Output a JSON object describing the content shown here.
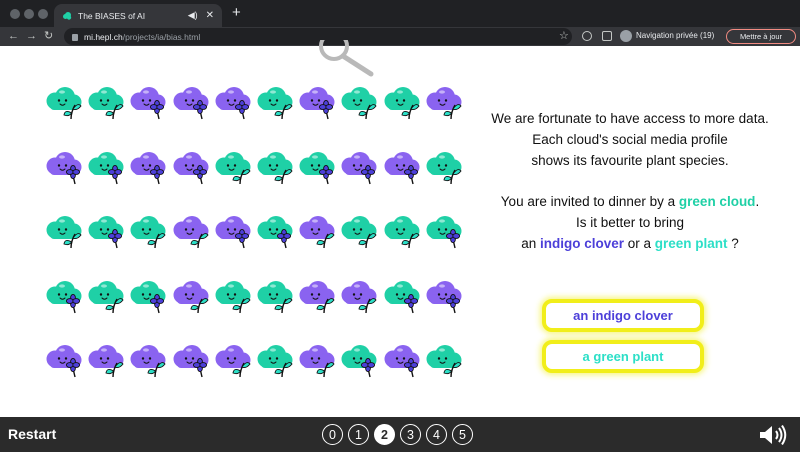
{
  "browser": {
    "tab_title": "The BIASES of AI",
    "url_host": "mi.hepl.ch",
    "url_path": "/projects/ia/bias.html",
    "incognito_label": "Navigation privée (19)",
    "update_label": "Mettre à jour"
  },
  "question": {
    "line1": "We are fortunate to have access to more data.",
    "line2": "Each cloud's social media profile",
    "line3": "shows its favourite plant species.",
    "line4_pre": "You are invited to dinner by a ",
    "line4_hl": "green cloud",
    "line4_post": ".",
    "line5": "Is it better to bring",
    "line6_pre": "an ",
    "line6_hl1": "indigo clover",
    "line6_mid": " or a ",
    "line6_hl2": "green plant",
    "line6_post": " ?"
  },
  "answers": {
    "option1": "an indigo clover",
    "option2": "a green plant"
  },
  "footer": {
    "restart_label": "Restart",
    "pages": [
      "0",
      "1",
      "2",
      "3",
      "4",
      "5"
    ],
    "active_page": "2"
  },
  "colors": {
    "green_cloud": "#1fd0a6",
    "indigo_cloud": "#8a63f0",
    "indigo_text": "#4c3fd9",
    "green_plant": "#2cdfc7",
    "highlight_yellow": "#f1ee1a",
    "footer_bg": "#2b2b2b"
  },
  "grid": {
    "rows": [
      [
        {
          "c": "green",
          "p": "leaf"
        },
        {
          "c": "green",
          "p": "leaf"
        },
        {
          "c": "indigo",
          "p": "clover"
        },
        {
          "c": "indigo",
          "p": "clover"
        },
        {
          "c": "indigo",
          "p": "clover"
        },
        {
          "c": "green",
          "p": "leaf"
        },
        {
          "c": "indigo",
          "p": "clover"
        },
        {
          "c": "green",
          "p": "leaf"
        },
        {
          "c": "green",
          "p": "leaf"
        },
        {
          "c": "indigo",
          "p": "leaf"
        }
      ],
      [
        {
          "c": "indigo",
          "p": "clover"
        },
        {
          "c": "green",
          "p": "clover"
        },
        {
          "c": "indigo",
          "p": "clover"
        },
        {
          "c": "indigo",
          "p": "clover"
        },
        {
          "c": "green",
          "p": "leaf"
        },
        {
          "c": "green",
          "p": "leaf"
        },
        {
          "c": "green",
          "p": "clover"
        },
        {
          "c": "indigo",
          "p": "clover"
        },
        {
          "c": "indigo",
          "p": "clover"
        },
        {
          "c": "green",
          "p": "leaf"
        }
      ],
      [
        {
          "c": "green",
          "p": "leaf"
        },
        {
          "c": "green",
          "p": "clover"
        },
        {
          "c": "green",
          "p": "leaf"
        },
        {
          "c": "indigo",
          "p": "leaf"
        },
        {
          "c": "indigo",
          "p": "clover"
        },
        {
          "c": "green",
          "p": "clover"
        },
        {
          "c": "indigo",
          "p": "leaf"
        },
        {
          "c": "green",
          "p": "leaf"
        },
        {
          "c": "green",
          "p": "leaf"
        },
        {
          "c": "green",
          "p": "clover"
        }
      ],
      [
        {
          "c": "green",
          "p": "clover"
        },
        {
          "c": "green",
          "p": "leaf"
        },
        {
          "c": "green",
          "p": "clover"
        },
        {
          "c": "indigo",
          "p": "leaf"
        },
        {
          "c": "green",
          "p": "leaf"
        },
        {
          "c": "green",
          "p": "leaf"
        },
        {
          "c": "indigo",
          "p": "leaf"
        },
        {
          "c": "indigo",
          "p": "leaf"
        },
        {
          "c": "green",
          "p": "clover"
        },
        {
          "c": "indigo",
          "p": "clover"
        }
      ],
      [
        {
          "c": "indigo",
          "p": "clover"
        },
        {
          "c": "indigo",
          "p": "leaf"
        },
        {
          "c": "indigo",
          "p": "leaf"
        },
        {
          "c": "indigo",
          "p": "clover"
        },
        {
          "c": "indigo",
          "p": "leaf"
        },
        {
          "c": "green",
          "p": "leaf"
        },
        {
          "c": "indigo",
          "p": "leaf"
        },
        {
          "c": "green",
          "p": "clover"
        },
        {
          "c": "indigo",
          "p": "clover"
        },
        {
          "c": "green",
          "p": "leaf"
        }
      ]
    ]
  }
}
